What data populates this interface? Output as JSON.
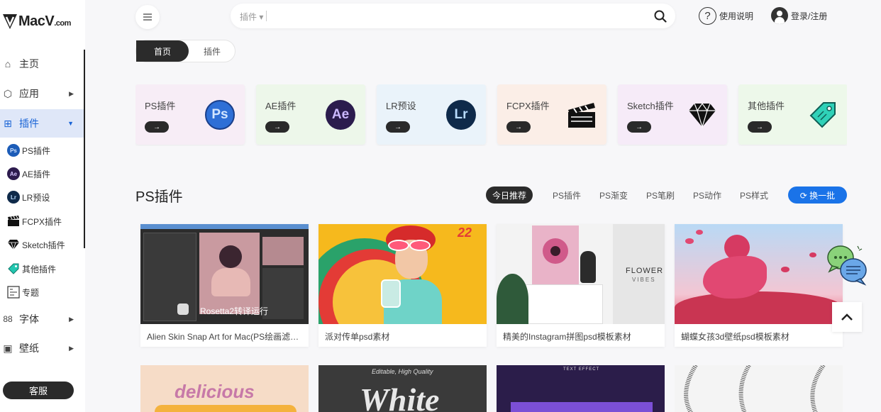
{
  "logo": {
    "text": "MacV",
    "suffix": ".com"
  },
  "sidebar": {
    "items": [
      {
        "label": "主页",
        "icon": "home-icon",
        "glyph": "⌂",
        "arrow": ""
      },
      {
        "label": "应用",
        "icon": "cube-icon",
        "glyph": "⬡",
        "arrow": "▶"
      },
      {
        "label": "插件",
        "icon": "plugin-icon",
        "glyph": "⊞",
        "arrow": "▼",
        "active": true
      },
      {
        "label": "字体",
        "icon": "font-icon",
        "glyph": "88",
        "arrow": "▶"
      },
      {
        "label": "壁纸",
        "icon": "wallpaper-icon",
        "glyph": "▣",
        "arrow": "▶"
      }
    ],
    "subitems": [
      {
        "label": "PS插件",
        "badge": "Ps"
      },
      {
        "label": "AE插件",
        "badge": "Ae"
      },
      {
        "label": "LR预设",
        "badge": "Lr"
      },
      {
        "label": "FCPX插件",
        "badge": "clapper"
      },
      {
        "label": "Sketch插件",
        "badge": "diamond"
      },
      {
        "label": "其他插件",
        "badge": "tag"
      },
      {
        "label": "专题",
        "badge": "topic"
      }
    ],
    "service_label": "客服"
  },
  "header": {
    "search_category": "插件 ▾",
    "help_label": "使用说明",
    "help_glyph": "?",
    "login_label": "登录/注册"
  },
  "tabs": {
    "home": "首页",
    "plugins": "插件"
  },
  "categories": [
    {
      "name": "PS插件",
      "btn": "→",
      "icon": "photoshop-icon",
      "badge": "Ps",
      "bg": "#f7edf6"
    },
    {
      "name": "AE插件",
      "btn": "→",
      "icon": "after-effects-icon",
      "badge": "Ae",
      "bg": "#edf7ea"
    },
    {
      "name": "LR预设",
      "btn": "→",
      "icon": "lightroom-icon",
      "badge": "Lr",
      "bg": "#eaf3fa"
    },
    {
      "name": "FCPX插件",
      "btn": "→",
      "icon": "clapperboard-icon",
      "badge": "",
      "bg": "#fbeee7"
    },
    {
      "name": "Sketch插件",
      "btn": "→",
      "icon": "diamond-icon",
      "badge": "",
      "bg": "#f6ebf8"
    },
    {
      "name": "其他插件",
      "btn": "→",
      "icon": "tag-icon",
      "badge": "",
      "bg": "#edf8ea"
    }
  ],
  "section": {
    "title": "PS插件",
    "filters": [
      "今日推荐",
      "PS插件",
      "PS渐变",
      "PS笔刷",
      "PS动作",
      "PS样式"
    ],
    "refresh_label": "⟳ 换一批"
  },
  "items": [
    {
      "title": "Alien Skin Snap Art for Mac(PS绘画滤镜插件)",
      "overlay": "Rosetta2转译运行"
    },
    {
      "title": "派对传单psd素材",
      "overlay": "22"
    },
    {
      "title": "精美的Instagram拼图psd模板素材",
      "overlay": "FLOWER",
      "overlay2": "VIBES"
    },
    {
      "title": "蝴蝶女孩3d壁纸psd模板素材",
      "overlay": ""
    }
  ],
  "items_row2": [
    {
      "overlay": "delicious"
    },
    {
      "overlay": "Editable, High Quality",
      "overlay2": "White"
    },
    {
      "overlay": "TEXT EFFECT"
    },
    {
      "overlay": ""
    }
  ],
  "colors": {
    "accent": "#1a73e8",
    "dark": "#2b2b2b",
    "active_nav_bg": "#dfe7f8"
  }
}
